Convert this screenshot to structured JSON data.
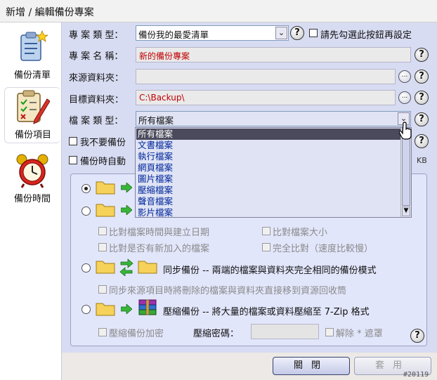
{
  "window": {
    "title": "新增 / 編輯備份專案"
  },
  "sidebar": {
    "items": [
      {
        "label": "備份清單",
        "icon": "clipboard-star-icon"
      },
      {
        "label": "備份項目",
        "icon": "checklist-pencil-icon"
      },
      {
        "label": "備份時間",
        "icon": "alarm-clock-icon"
      }
    ]
  },
  "form": {
    "project_type": {
      "label": "專 案 類 型：",
      "value": "備份我的最愛清單",
      "help": "?"
    },
    "first_check": {
      "label": "請先勾選此按鈕再設定"
    },
    "project_name": {
      "label": "專 案 名 稱：",
      "value": "新的備份專案"
    },
    "source_folder": {
      "label": "來源資料夾：",
      "value": ""
    },
    "target_folder": {
      "label": "目標資料夾：",
      "value": "C:\\Backup\\"
    },
    "file_type": {
      "label": "檔 案 類 型：",
      "value": "所有檔案"
    },
    "option1": {
      "label": "我不要備份"
    },
    "option2": {
      "label": "備份時自動"
    },
    "kb_unit": "KB",
    "browse": "...",
    "help": "?"
  },
  "file_type_dropdown": {
    "options": [
      "所有檔案",
      "文書檔案",
      "執行檔案",
      "網頁檔案",
      "圖片檔案",
      "壓縮檔案",
      "聲音檔案",
      "影片檔案"
    ],
    "selected_index": 0
  },
  "modes": {
    "incremental_options": {
      "compare_time": "比對檔案時間與建立日期",
      "compare_size": "比對檔案大小",
      "compare_new": "比對是否有新加入的檔案",
      "full_compare": "完全比對（速度比較慢）"
    },
    "sync": {
      "title": "同步備份 -- 兩端的檔案與資料夾完全相同的備份模式",
      "option": "同步來源項目時將刪除的檔案與資料夾直接移到資源回收筒"
    },
    "compress": {
      "title": "壓縮備份 -- 將大量的檔案或資料壓縮至 7-Zip 格式",
      "encrypt": "壓縮備份加密",
      "password_label": "壓縮密碼：",
      "password_value": "",
      "unmask": "解除 * 遮罩"
    }
  },
  "footer": {
    "close_label": "關閉",
    "apply_label": "套用",
    "watermark": "#20119"
  },
  "colors": {
    "panel": "#d8dcf2",
    "dropdown_text": "#00279a",
    "field_red": "#c00000"
  }
}
